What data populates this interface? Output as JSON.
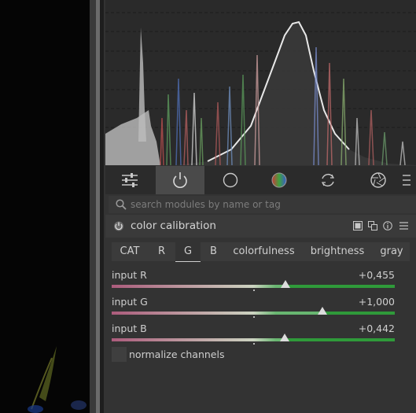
{
  "search": {
    "placeholder": "search modules by name or tag"
  },
  "module": {
    "title": "color calibration",
    "tabs": [
      {
        "label": "CAT"
      },
      {
        "label": "R"
      },
      {
        "label": "G",
        "active": true
      },
      {
        "label": "B"
      },
      {
        "label": "colorfulness"
      },
      {
        "label": "brightness"
      },
      {
        "label": "gray"
      }
    ],
    "sliders": [
      {
        "label": "input R",
        "value": "+0,455",
        "level": 0.615
      },
      {
        "label": "input G",
        "value": "+1,000",
        "level": 0.745
      },
      {
        "label": "input B",
        "value": "+0,442",
        "level": 0.611
      }
    ],
    "normalize_label": "normalize channels"
  },
  "module_groups": [
    {
      "icon": "sliders-icon"
    },
    {
      "icon": "power-icon",
      "active": true
    },
    {
      "icon": "circle-icon"
    },
    {
      "icon": "color-wheel-icon"
    },
    {
      "icon": "rotate-icon"
    },
    {
      "icon": "aperture-icon"
    },
    {
      "icon": "menu-icon"
    }
  ],
  "colors": {
    "slider_gradient_left": "#8c1d4a",
    "slider_gradient_mid": "#b9c3a9",
    "slider_gradient_right": "#2f9a3a",
    "color_wheel": "#3ea23e"
  }
}
